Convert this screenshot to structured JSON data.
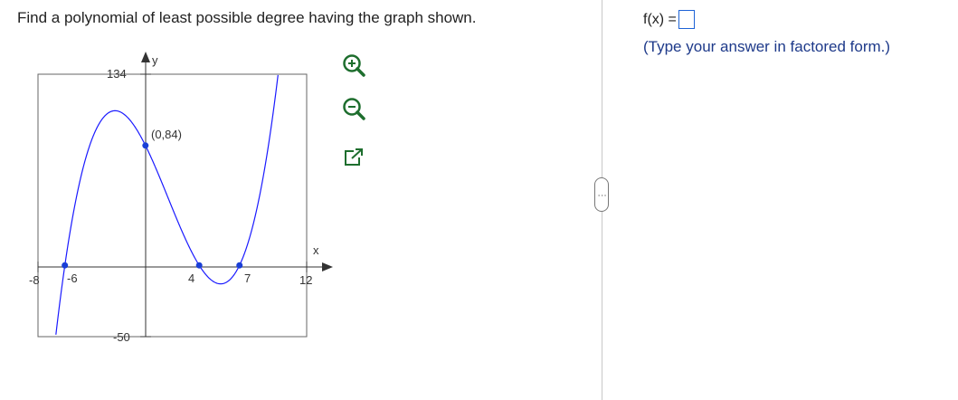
{
  "question": "Find a polynomial of least possible degree having the graph shown.",
  "graph": {
    "y_axis_label": "y",
    "x_axis_label": "x",
    "ticks": {
      "x_min": "-8",
      "x_neg": "-6",
      "x_four": "4",
      "x_seven": "7",
      "x_max": "12",
      "y_max": "134",
      "y_min": "-50"
    },
    "point_label": "(0,84)",
    "curve_color": "#1a1aff",
    "point_color": "#1a3fd6",
    "points": [
      {
        "x": -6,
        "y": 0
      },
      {
        "x": 0,
        "y": 84
      },
      {
        "x": 4,
        "y": 0
      },
      {
        "x": 7,
        "y": 0
      }
    ],
    "xlim": [
      -8,
      12
    ],
    "ylim": [
      -50,
      134
    ]
  },
  "tools": [
    "zoom-in-icon",
    "zoom-out-icon",
    "open-new-window-icon"
  ],
  "answer": {
    "prefix": "f(x) =",
    "hint": "(Type your answer in factored form.)"
  },
  "divider_handle_label": "⋮"
}
